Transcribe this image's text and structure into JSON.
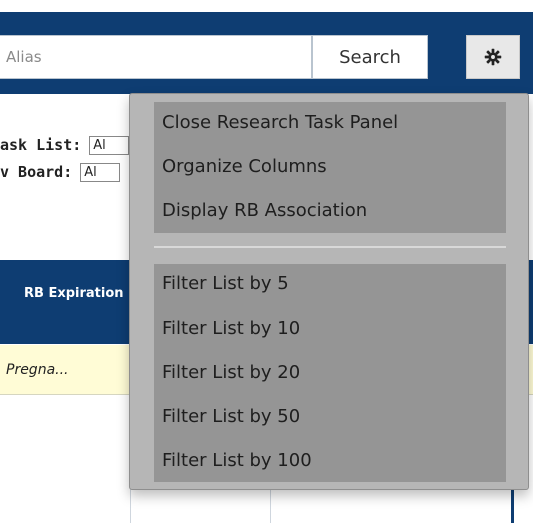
{
  "search": {
    "placeholder": "Alias",
    "button_label": "Search"
  },
  "settings": {
    "icon": "gear-icon"
  },
  "filters": [
    {
      "label": "ask List:",
      "value": "Al"
    },
    {
      "label": "v Board:",
      "value": "Al"
    }
  ],
  "table": {
    "header": {
      "column_label": "RB Expiration"
    },
    "row": {
      "cell_text": "Pregna..."
    }
  },
  "menu": {
    "group1": [
      "Close Research Task Panel",
      "Organize Columns",
      "Display RB Association"
    ],
    "group2": [
      "Filter List by 5",
      "Filter List by 10",
      "Filter List by 20",
      "Filter List by 50",
      "Filter List by 100"
    ]
  },
  "colors": {
    "header_blue": "#0e3d72",
    "menu_bg": "#b6b6b6",
    "menu_group_bg": "#959595",
    "row_highlight": "#fffcd6"
  }
}
